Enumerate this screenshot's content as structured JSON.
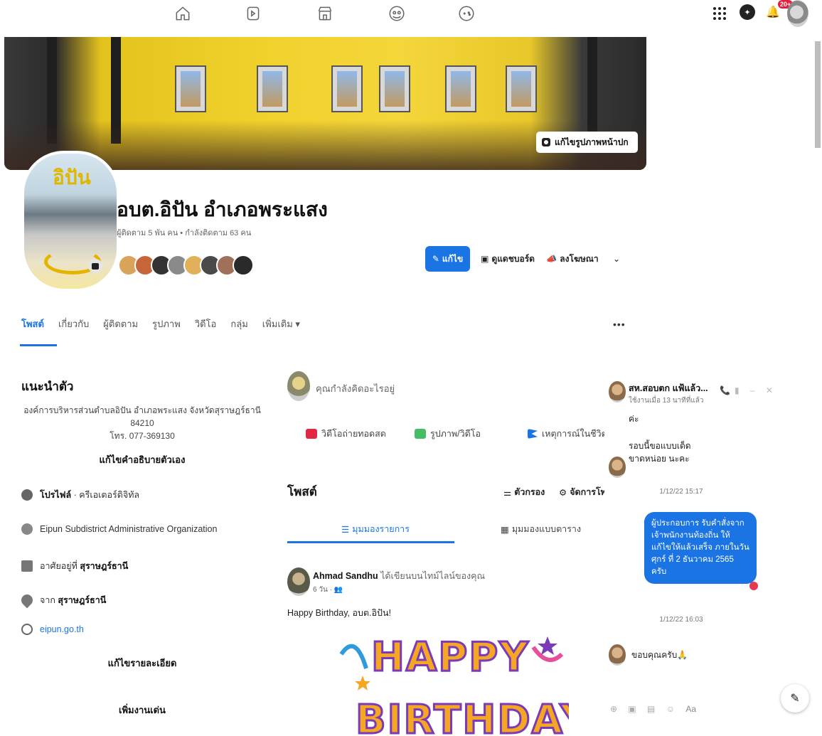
{
  "cover": {
    "edit_label": "แก้ไขรูปภาพหน้าปก"
  },
  "profile": {
    "name": "อบต.อิปัน อำเภอพระแสง",
    "followers": "ผู้ติดตาม 5 พัน คน • กำลังติดตาม 63 คน",
    "logo_text": "อิปัน"
  },
  "actions": {
    "edit": "แก้ไข",
    "dashboard": "ดูแดชบอร์ด",
    "advertise": "ลงโฆษณา"
  },
  "tabs": [
    "โพสต์",
    "เกี่ยวกับ",
    "ผู้ติดตาม",
    "รูปภาพ",
    "วิดีโอ",
    "กลุ่ม",
    "เพิ่มเติม ▾"
  ],
  "intro": {
    "title": "แนะนำตัว",
    "description": "องค์การบริหารส่วนตำบลอิปัน อำเภอพระแสง จังหวัดสุราษฎร์ธานี 84210",
    "phone": "โทร. 077-369130",
    "edit_bio": "แก้ไขคำอธิบายตัวเอง",
    "items": [
      {
        "label": "โปรไฟล์",
        "value": " · ครีเอเตอร์ดิจิทัล"
      },
      {
        "label": "",
        "value": "Eipun Subdistrict Administrative Organization"
      },
      {
        "label": "อาศัยอยู่ที่ ",
        "value": "สุราษฎร์ธานี"
      },
      {
        "label": "จาก ",
        "value": "สุราษฎร์ธานี"
      },
      {
        "label": "",
        "value": "eipun.go.th"
      }
    ],
    "edit_details": "แก้ไขรายละเอียด",
    "add_featured": "เพิ่มงานเด่น"
  },
  "composer": {
    "placeholder": "คุณกำลังคิดอะไรอยู่",
    "live": "วิดีโอถ่ายทอดสด",
    "photo": "รูปภาพ/วิดีโอ",
    "life_event": "เหตุการณ์ในชีวิต"
  },
  "posts": {
    "title": "โพสต์",
    "filters": "ตัวกรอง",
    "manage": "จัดการโพ",
    "list_view": "มุมมองรายการ",
    "grid_view": "มุมมองแบบตาราง"
  },
  "post": {
    "author": "Ahmad Sandhu",
    "action": " ได้เขียนบนไทม์ไลน์ของคุณ",
    "meta": "6 วัน · ",
    "text": "Happy Birthday, อบต.อิปัน!",
    "image_text_1": "HAPPY",
    "image_text_2": "BIRTHDAY"
  },
  "chat": {
    "name": "สห.สอบตก แฟ้แล้ว...",
    "status": "ใช้งานเมื่อ 13 นาทีที่แล้ว",
    "msg1": "ค่ะ",
    "msg2": "รอบนี้ขอแบบเด็ดขาดหน่อย นะคะ",
    "time1": "1/12/22 15:17",
    "out_msg": "ผู้ประกอบการ รับคำสั่งจากเจ้าพนักงานท้องถิ่น ให้แก้ไขให้แล้วเสร็จ ภายในวันศุกร์ ที่ 2 ธันวาคม 2565 ครับ",
    "time2": "1/12/22 16:03",
    "msg3": "ขอบคุณครับ🙏",
    "composer_placeholder": "Aa"
  },
  "notifications_badge": "20+",
  "colors": {
    "accent": "#1b74e4",
    "heart": "#e53950"
  }
}
